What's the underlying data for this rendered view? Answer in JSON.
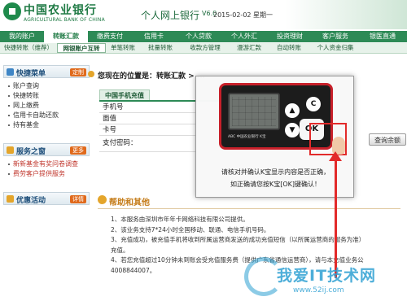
{
  "header": {
    "bank_name_cn": "中国农业银行",
    "bank_name_en": "AGRICULTURAL BANK OF CHINA",
    "system_title": "个人网上银行",
    "version": "V6.0",
    "date": "2015-02-02 星期一"
  },
  "main_nav": [
    {
      "label": "我的账户",
      "active": false
    },
    {
      "label": "转账汇款",
      "active": true
    },
    {
      "label": "缴费支付",
      "active": false
    },
    {
      "label": "信用卡",
      "active": false
    },
    {
      "label": "个人贷款",
      "active": false
    },
    {
      "label": "个人外汇",
      "active": false
    },
    {
      "label": "投资理财",
      "active": false
    },
    {
      "label": "客户服务",
      "active": false
    },
    {
      "label": "银医直通",
      "active": false
    }
  ],
  "sub_nav": [
    {
      "label": "快捷转账（维荐）",
      "active": false
    },
    {
      "label": "网银账户互转",
      "active": true
    },
    {
      "label": "单笔转账",
      "active": false
    },
    {
      "label": "批量转账",
      "active": false
    },
    {
      "label": "收款方管理",
      "active": false
    },
    {
      "label": "漫游汇款",
      "active": false
    },
    {
      "label": "自动转账",
      "active": false
    },
    {
      "label": "个人资金归集",
      "active": false
    }
  ],
  "sidebar": {
    "quick_menu": {
      "title": "快捷菜单",
      "action": "定制",
      "items": [
        "账户查询",
        "快捷转账",
        "网上缴费",
        "信用卡自助还款",
        "持有基金"
      ]
    },
    "service_window": {
      "title": "服务之窗",
      "action": "更多",
      "items": [
        "新新基金有奖问卷调查",
        "费劳客户提供服务"
      ]
    },
    "promotions": {
      "title": "优惠活动",
      "action": "详情"
    }
  },
  "main": {
    "location_text": "您现在的位置是：转账汇款 > ...",
    "tab_label": "中国手机充值",
    "form_rows": [
      "手机号",
      "面值",
      "卡号",
      "支付密码："
    ],
    "query_button": "查询余额",
    "help_title": "帮助和其他",
    "help_lines": [
      "1、本服务由深圳市年年卡网络科技有限公司提供。",
      "2、该业务支持7*24小时全国移动、联通、电信手机号码。",
      "3、充值成功，被充值手机将收到所属运营商发送的成功充值短信（以所属运营商的服务为准）",
      "    充值。",
      "4、若您充值超过10分钟未到账会受充值服务费（提供广东省通信运营商），请与本充值业务公",
      "    4008844007。"
    ]
  },
  "modal": {
    "ok_label": "OK",
    "c_label": "C",
    "device_brand": "ABC  中国农业银行  K宝",
    "line1": "请核对并确认K宝显示内容是否正确，",
    "line2": "如正确请您按K宝[OK]键确认！"
  },
  "watermark": {
    "text": "我爱IT技术网",
    "url": "www.52ij.com"
  },
  "colors": {
    "brand_green": "#2d8a56",
    "highlight_red": "#e22a2a",
    "help_orange": "#c47a15"
  }
}
